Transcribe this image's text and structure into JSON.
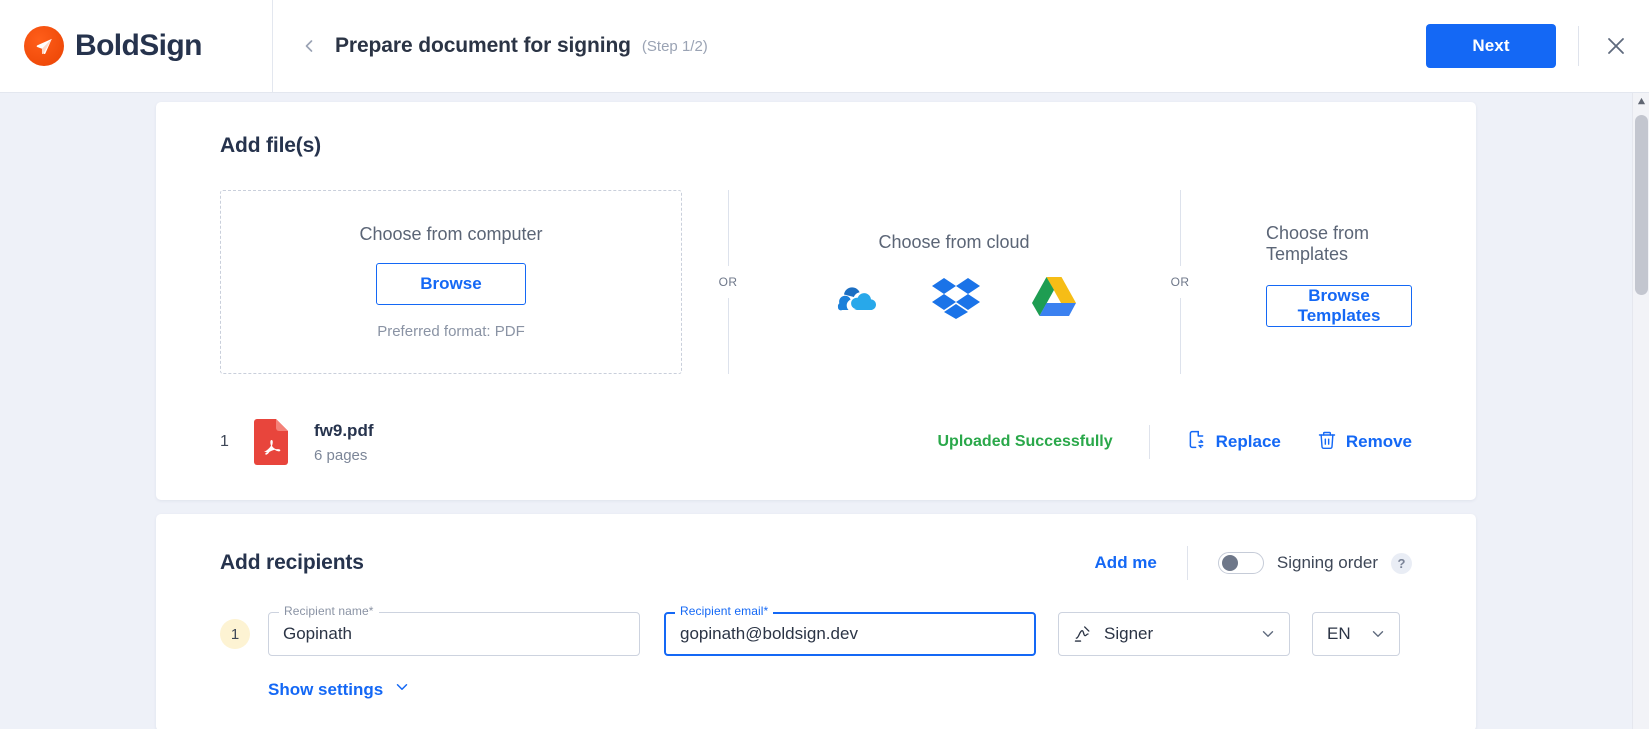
{
  "header": {
    "brand": "BoldSign",
    "brand_icon": "boldsign-logo-icon",
    "back_icon": "chevron-left-icon",
    "title": "Prepare document for signing",
    "step": "(Step 1/2)",
    "next_label": "Next",
    "close_icon": "close-icon",
    "accent_blue": "#1468f5",
    "brand_orange": "#f4511e",
    "brand_navy": "#26334d"
  },
  "files_section": {
    "title": "Add file(s)",
    "computer": {
      "title": "Choose from computer",
      "browse_label": "Browse",
      "note": "Preferred format: PDF"
    },
    "or_left": "OR",
    "or_right": "OR",
    "cloud": {
      "title": "Choose from cloud",
      "providers": [
        {
          "name": "onedrive-icon",
          "label": "OneDrive"
        },
        {
          "name": "dropbox-icon",
          "label": "Dropbox"
        },
        {
          "name": "google-drive-icon",
          "label": "Google Drive"
        }
      ]
    },
    "templates": {
      "title": "Choose from Templates",
      "browse_label": "Browse Templates"
    },
    "uploaded": [
      {
        "index": "1",
        "name": "fw9.pdf",
        "pages": "6 pages",
        "status": "Uploaded Successfully",
        "status_color": "#2aa84a",
        "replace_label": "Replace",
        "remove_label": "Remove"
      }
    ]
  },
  "recipients_section": {
    "title": "Add recipients",
    "add_me_label": "Add me",
    "signing_order_label": "Signing order",
    "signing_order_on": false,
    "help_glyph": "?",
    "rows": [
      {
        "index": "1",
        "name_label": "Recipient name*",
        "name_value": "Gopinath",
        "name_placeholder": "Recipient name*",
        "email_label": "Recipient email*",
        "email_value": "gopinath@boldsign.dev",
        "email_placeholder": "Recipient email*",
        "role_value": "Signer",
        "language_value": "EN"
      }
    ],
    "show_settings_label": "Show settings"
  },
  "scrollbar": {
    "up_glyph": "▲",
    "down_glyph": "▼"
  }
}
